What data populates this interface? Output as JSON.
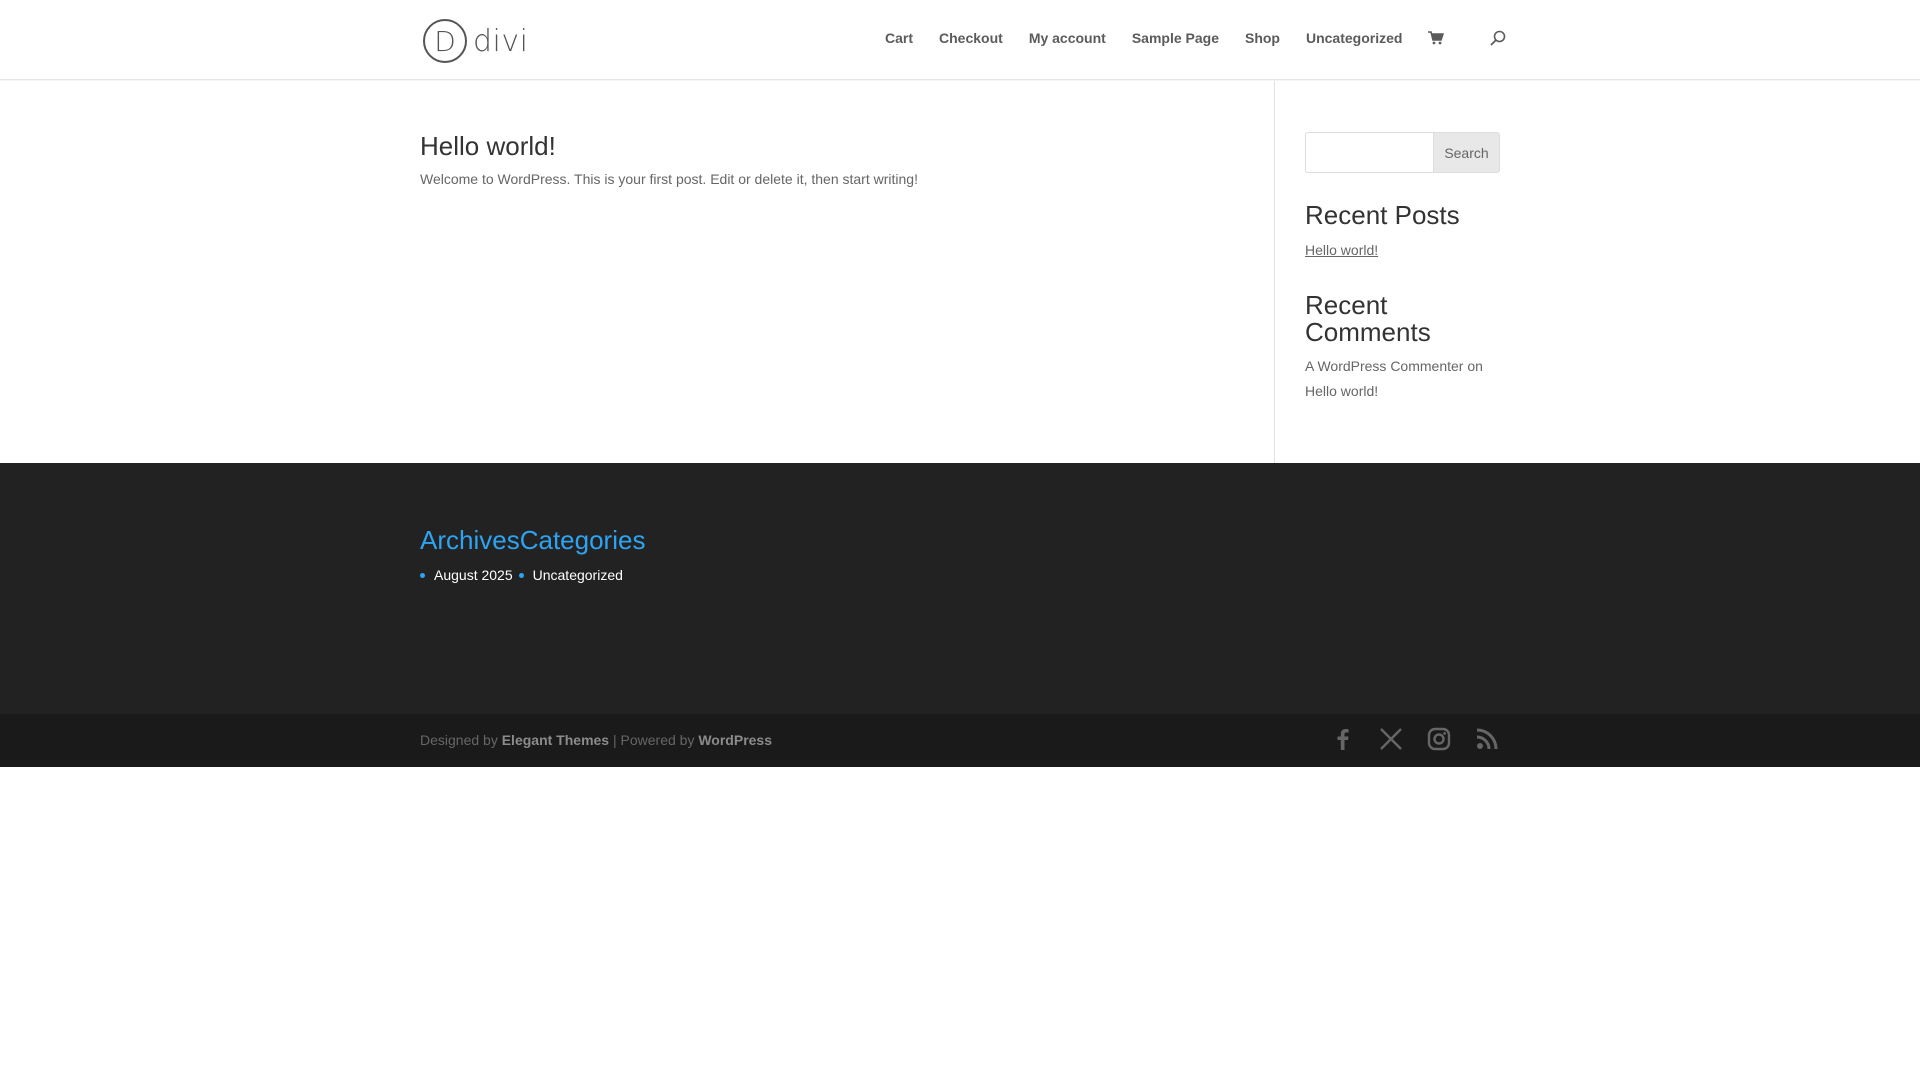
{
  "header": {
    "logo_text": "divi",
    "logo_letter": "D",
    "nav": [
      {
        "label": "Cart"
      },
      {
        "label": "Checkout"
      },
      {
        "label": "My account"
      },
      {
        "label": "Sample Page"
      },
      {
        "label": "Shop"
      },
      {
        "label": "Uncategorized"
      }
    ],
    "icons": [
      "cart-icon",
      "search-icon"
    ]
  },
  "post": {
    "title": "Hello world!",
    "excerpt": "Welcome to WordPress. This is your first post. Edit or delete it, then start writing!"
  },
  "sidebar": {
    "search": {
      "placeholder": "",
      "button_label": "Search"
    },
    "recent_posts": {
      "title": "Recent Posts",
      "items": [
        "Hello world!"
      ]
    },
    "recent_comments": {
      "title_line1": "Recent",
      "title_line2": "Comments",
      "author": "A WordPress Commenter",
      "on": "on",
      "post": "Hello world!"
    }
  },
  "footer": {
    "archives_title": "Archives",
    "categories_title": "Categories",
    "archives_items": [
      "August 2025"
    ],
    "categories_items": [
      "Uncategorized"
    ],
    "credits": {
      "designed_by": "Designed by",
      "elegant": "Elegant Themes",
      "separator": "| Powered by",
      "wordpress": "WordPress"
    },
    "social_icons": [
      "facebook-icon",
      "x-icon",
      "instagram-icon",
      "rss-icon"
    ]
  },
  "colors": {
    "accent": "#2ea3f2",
    "footer_bg": "#222222",
    "bottom_bar_bg": "#1a1a1a"
  }
}
